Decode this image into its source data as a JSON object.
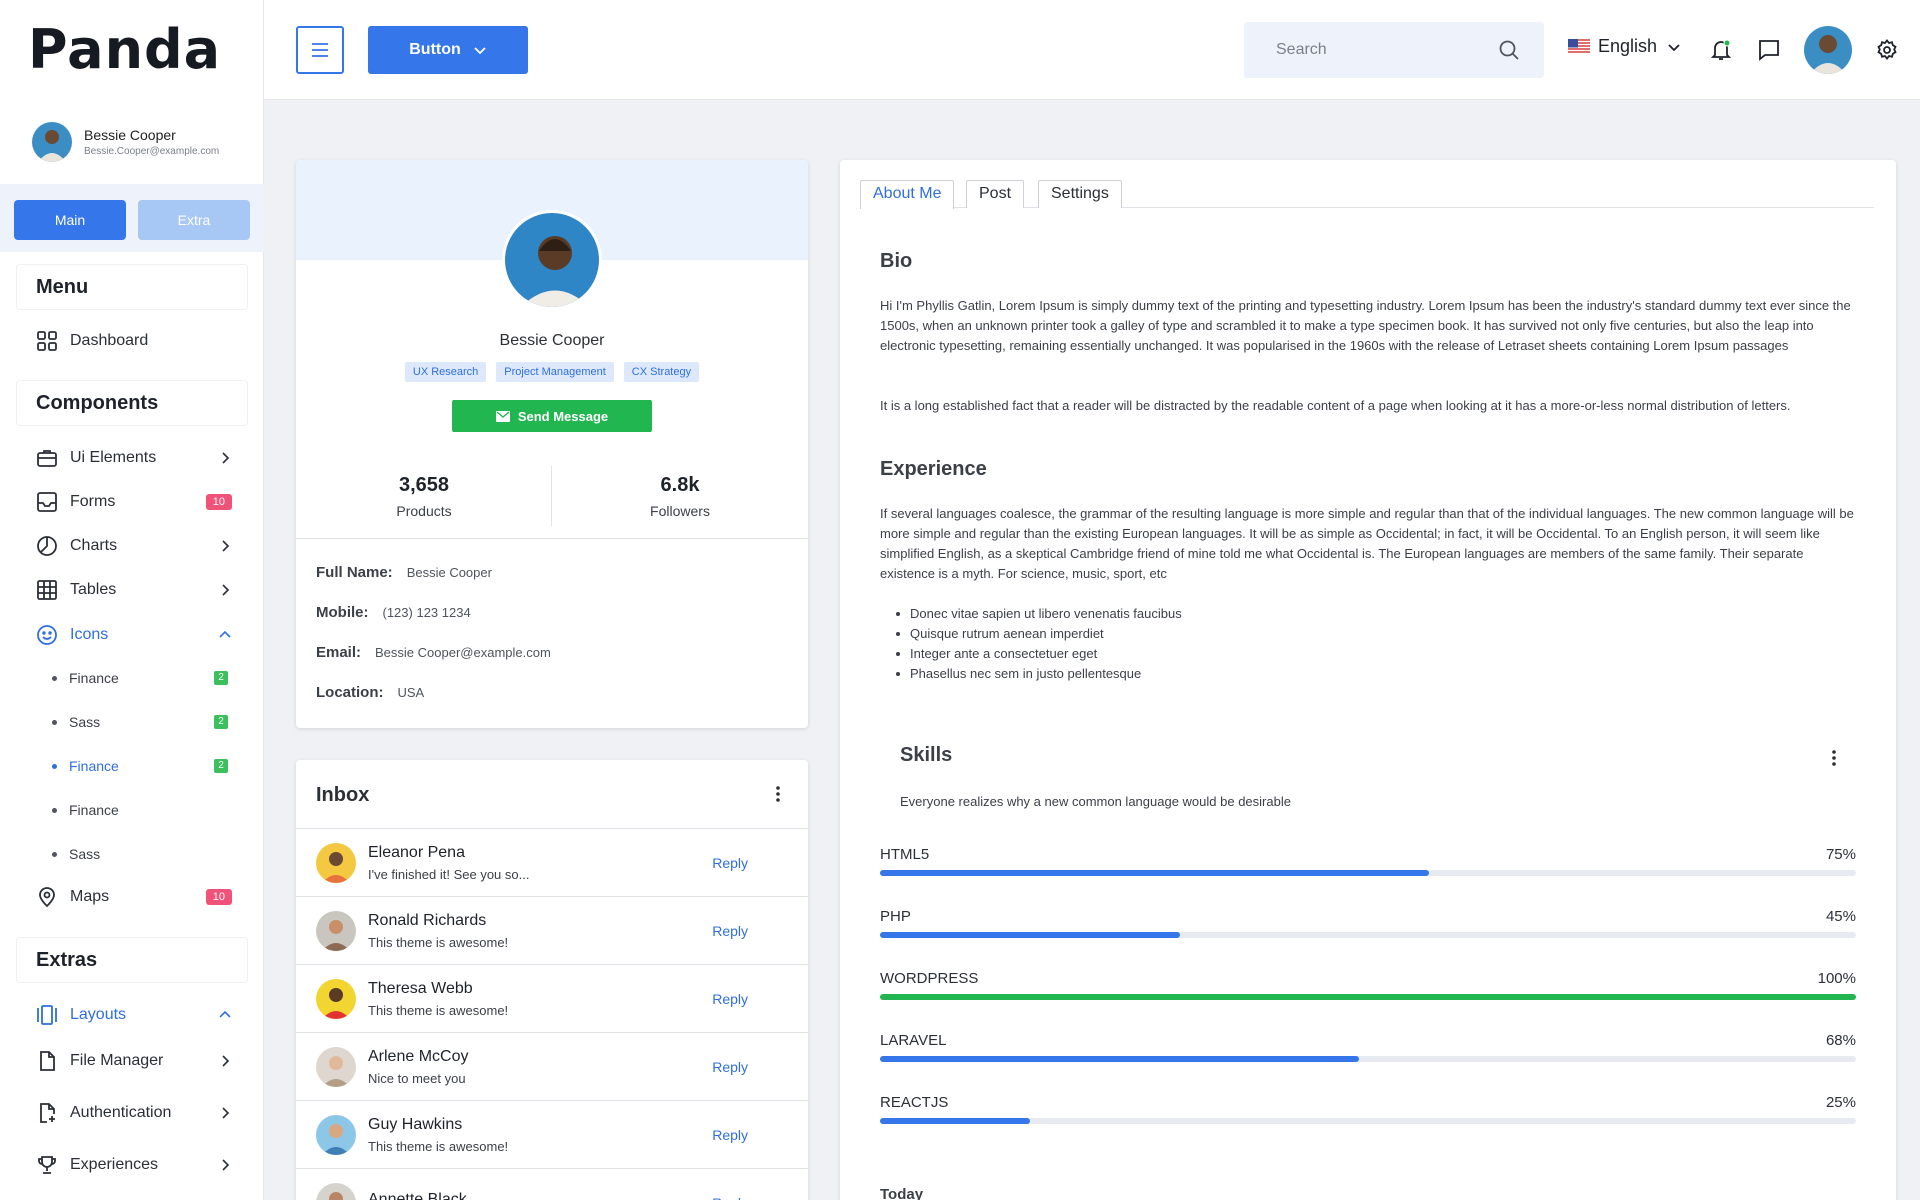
{
  "brand": {
    "name": "Panda"
  },
  "sidebar_user": {
    "name": "Bessie Cooper",
    "email": "Bessie.Cooper@example.com"
  },
  "sidebar_tabs": {
    "main": "Main",
    "extra": "Extra"
  },
  "sections": {
    "menu": "Menu",
    "components": "Components",
    "extras": "Extras"
  },
  "nav": {
    "dashboard": "Dashboard",
    "ui_elements": "Ui Elements",
    "forms": "Forms",
    "forms_badge": "10",
    "charts": "Charts",
    "tables": "Tables",
    "icons": "Icons",
    "icons_sub": [
      {
        "label": "Finance",
        "badge": "2"
      },
      {
        "label": "Sass",
        "badge": "2"
      },
      {
        "label": "Finance",
        "badge": "2"
      },
      {
        "label": "Finance"
      },
      {
        "label": "Sass"
      }
    ],
    "maps": "Maps",
    "maps_badge": "10",
    "layouts": "Layouts",
    "file_manager": "File Manager",
    "authentication": "Authentication",
    "experiences": "Experiences"
  },
  "topbar": {
    "button_label": "Button",
    "search_placeholder": "Search",
    "language": "English"
  },
  "profile": {
    "name": "Bessie Cooper",
    "tags": [
      "UX Research",
      "Project Management",
      "CX Strategy"
    ],
    "send_label": "Send Message",
    "stats": [
      {
        "value": "3,658",
        "label": "Products"
      },
      {
        "value": "6.8k",
        "label": "Followers"
      }
    ],
    "info": [
      {
        "key": "Full Name:",
        "value": "Bessie Cooper"
      },
      {
        "key": "Mobile:",
        "value": "(123) 123 1234"
      },
      {
        "key": "Email:",
        "value": "Bessie Cooper@example.com"
      },
      {
        "key": "Location:",
        "value": "USA"
      }
    ]
  },
  "inbox": {
    "title": "Inbox",
    "reply_label": "Reply",
    "messages": [
      {
        "name": "Eleanor Pena",
        "text": "I've finished it! See you so..."
      },
      {
        "name": "Ronald Richards",
        "text": "This theme is awesome!"
      },
      {
        "name": "Theresa Webb",
        "text": "This theme is awesome!"
      },
      {
        "name": "Arlene McCoy",
        "text": "Nice to meet you"
      },
      {
        "name": "Guy Hawkins",
        "text": "This theme is awesome!"
      },
      {
        "name": "Annette Black",
        "text": ""
      }
    ]
  },
  "tabs": [
    "About Me",
    "Post",
    "Settings"
  ],
  "about": {
    "bio_title": "Bio",
    "bio_p1": "Hi I'm Phyllis Gatlin, Lorem Ipsum is simply dummy text of the printing and typesetting industry. Lorem Ipsum has been the industry's standard dummy text ever since the 1500s, when an unknown printer took a galley of type and scrambled it to make a type specimen book. It has survived not only five centuries, but also the leap into electronic typesetting, remaining essentially unchanged. It was popularised in the 1960s with the release of Letraset sheets containing Lorem Ipsum passages",
    "bio_p2": "It is a long established fact that a reader will be distracted by the readable content of a page when looking at it has a more-or-less normal distribution of letters.",
    "exp_title": "Experience",
    "exp_p": "If several languages coalesce, the grammar of the resulting language is more simple and regular than that of the individual languages. The new common language will be more simple and regular than the existing European languages. It will be as simple as Occidental; in fact, it will be Occidental. To an English person, it will seem like simplified English, as a skeptical Cambridge friend of mine told me what Occidental is. The European languages are members of the same family. Their separate existence is a myth. For science, music, sport, etc",
    "exp_bullets": [
      "Donec vitae sapien ut libero venenatis faucibus",
      "Quisque rutrum aenean imperdiet",
      "Integer ante a consectetuer eget",
      "Phasellus nec sem in justo pellentesque"
    ]
  },
  "skills": {
    "title": "Skills",
    "subtitle": "Everyone realizes why a new common language would be desirable",
    "items": [
      {
        "name": "HTML5",
        "percent_label": "75%",
        "fill": 0.563,
        "color": "#3576ea"
      },
      {
        "name": "PHP",
        "percent_label": "45%",
        "fill": 0.307,
        "color": "#3576ea"
      },
      {
        "name": "WORDPRESS",
        "percent_label": "100%",
        "fill": 1.0,
        "color": "#21b650"
      },
      {
        "name": "LARAVEL",
        "percent_label": "68%",
        "fill": 0.491,
        "color": "#3576ea"
      },
      {
        "name": "REACTJS",
        "percent_label": "25%",
        "fill": 0.154,
        "color": "#3576ea"
      }
    ]
  },
  "today_label": "Today"
}
